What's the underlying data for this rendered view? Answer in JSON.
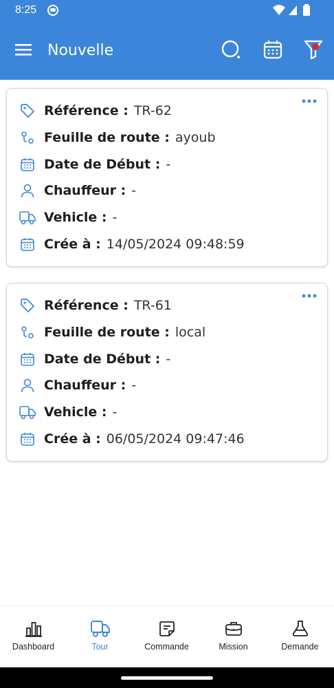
{
  "status_bar": {
    "time": "8:25"
  },
  "toolbar": {
    "title": "Nouvelle",
    "icons": [
      "menu-icon",
      "search-icon",
      "calendar-icon",
      "filter-icon"
    ],
    "accent": "#3b86da"
  },
  "cards": [
    {
      "reference_label": "Référence :",
      "reference": "TR-62",
      "route_label": "Feuille de route :",
      "route": "ayoub",
      "start_label": "Date de Début :",
      "start": "-",
      "driver_label": "Chauffeur :",
      "driver": "-",
      "vehicle_label": "Vehicle :",
      "vehicle": "-",
      "created_label": "Crée à :",
      "created": "14/05/2024 09:48:59"
    },
    {
      "reference_label": "Référence :",
      "reference": "TR-61",
      "route_label": "Feuille de route :",
      "route": "local",
      "start_label": "Date de Début :",
      "start": "-",
      "driver_label": "Chauffeur :",
      "driver": "-",
      "vehicle_label": "Vehicle :",
      "vehicle": "-",
      "created_label": "Crée à :",
      "created": "06/05/2024 09:47:46"
    }
  ],
  "bottom_nav": [
    {
      "label": "Dashboard",
      "icon": "bar-chart-icon",
      "active": false
    },
    {
      "label": "Tour",
      "icon": "truck-icon",
      "active": true
    },
    {
      "label": "Commande",
      "icon": "note-icon",
      "active": false
    },
    {
      "label": "Mission",
      "icon": "briefcase-icon",
      "active": false
    },
    {
      "label": "Demande",
      "icon": "flask-icon",
      "active": false
    }
  ]
}
